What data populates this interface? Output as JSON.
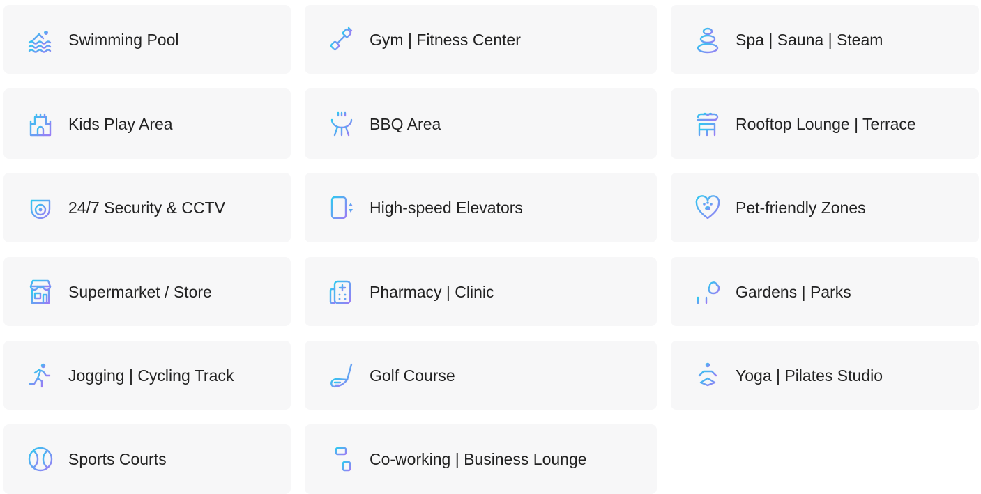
{
  "colors": {
    "card_background": "#f7f7f8",
    "text": "#222222",
    "icon_gradient_start": "#30c8f0",
    "icon_gradient_end": "#9a7cf5"
  },
  "amenities": [
    {
      "label": "Swimming Pool",
      "icon": "swimming-pool-icon"
    },
    {
      "label": "Gym | Fitness Center",
      "icon": "dumbbell-icon"
    },
    {
      "label": "Spa | Sauna | Steam",
      "icon": "spa-stones-icon"
    },
    {
      "label": "Kids Play Area",
      "icon": "castle-icon"
    },
    {
      "label": "BBQ Area",
      "icon": "bbq-grill-icon"
    },
    {
      "label": "Rooftop Lounge | Terrace",
      "icon": "rooftop-lounge-icon"
    },
    {
      "label": "24/7 Security & CCTV",
      "icon": "security-camera-icon"
    },
    {
      "label": "High-speed Elevators",
      "icon": "elevator-icon"
    },
    {
      "label": "Pet-friendly Zones",
      "icon": "pet-heart-icon"
    },
    {
      "label": "Supermarket / Store",
      "icon": "store-icon"
    },
    {
      "label": "Pharmacy | Clinic",
      "icon": "clinic-icon"
    },
    {
      "label": "Gardens | Parks",
      "icon": "park-bench-tree-icon"
    },
    {
      "label": "Jogging | Cycling Track",
      "icon": "runner-icon"
    },
    {
      "label": "Golf Course",
      "icon": "golf-club-icon"
    },
    {
      "label": "Yoga | Pilates Studio",
      "icon": "yoga-icon"
    },
    {
      "label": "Sports Courts",
      "icon": "sports-ball-icon"
    },
    {
      "label": "Co-working | Business Lounge",
      "icon": "coworking-desk-icon"
    }
  ]
}
